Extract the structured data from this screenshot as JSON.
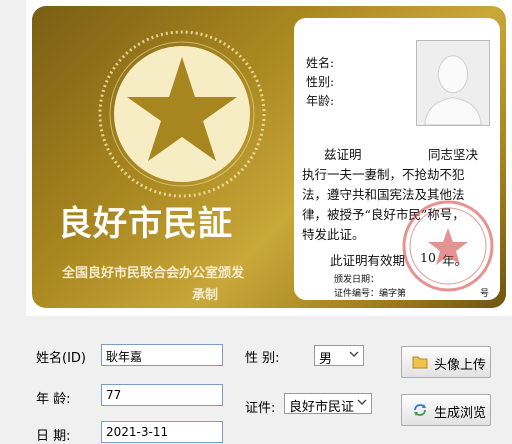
{
  "card": {
    "title": "良好市民証",
    "issuer_line1": "全国良好市民联合会办公室颁发",
    "issuer_line2": "承制",
    "name_label": "姓名:",
    "gender_label": "性别:",
    "age_label": "年龄:",
    "cert_line1_a": "兹证明",
    "cert_line1_b": "同志坚决",
    "cert_line2": "执行一夫一妻制，不抢劫不犯",
    "cert_line3": "法，遵守共和国宪法及其他法",
    "cert_line4": "律，被授予“良好市民”称号，",
    "cert_line5": "特发此证。",
    "valid_a": "此证明有效期",
    "valid_years": "10",
    "valid_b": "年。",
    "issue_date_label": "颁发日期：",
    "cert_no_label": "证件编号：编字第",
    "cert_no_suffix": "号"
  },
  "form": {
    "name_label": "姓名(ID)",
    "name_value": "耿年嘉",
    "age_label": "年   龄:",
    "age_value": "77",
    "date_label": "日   期:",
    "date_value": "2021-3-11",
    "gender_label": "性    别:",
    "gender_value": "男",
    "cert_label": "证件:",
    "cert_value": "良好市民证",
    "upload_button": "头像上传",
    "generate_button": "生成浏览"
  },
  "colors": {
    "gold_dark": "#7a5e14",
    "gold_light": "#c9a83a",
    "seal_red": "#d23a3a",
    "input_border": "#7a9cc6"
  }
}
